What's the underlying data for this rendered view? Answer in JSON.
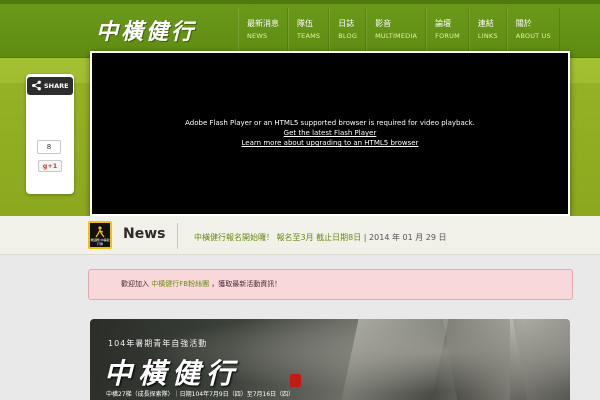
{
  "header": {
    "logo_text": "中橫健行",
    "nav": [
      {
        "zh": "最新消息",
        "en": "NEWS"
      },
      {
        "zh": "隊伍",
        "en": "TEAMS"
      },
      {
        "zh": "日誌",
        "en": "BLOG"
      },
      {
        "zh": "影音",
        "en": "MULTIMEDIA"
      },
      {
        "zh": "論壇",
        "en": "FORUM"
      },
      {
        "zh": "連結",
        "en": "LINKS"
      },
      {
        "zh": "關於",
        "en": "ABOUT US"
      }
    ]
  },
  "share": {
    "label": "SHARE",
    "count": "8",
    "gplus_label": "g+1",
    "icon": "share-icon"
  },
  "player": {
    "message": "Adobe Flash Player or an HTML5 supported browser is required for video playback.",
    "link1": "Get the latest Flash Player",
    "link2": "Learn more about upgrading to an HTML5 browser"
  },
  "news": {
    "logo_caption": "救國團 中橫健行隊",
    "title": "News",
    "headline": "中橫健行報名開始囉！ 報名至3月 截止日期8日",
    "separator": " | ",
    "date": "2014 年 01 月 29 日"
  },
  "notice": {
    "prefix": "歡迎加入",
    "link": "中橫健行FB粉絲團",
    "suffix": "，獲取最新活動資訊！"
  },
  "banner": {
    "subtitle": "104年暑期青年自強活動",
    "title": "中橫健行",
    "info": "中橫27梯（成長探索隊）｜日期104年7月9日（四）至7月16日（四）"
  },
  "colors": {
    "header_green": "#5e8c12",
    "hero_green": "#9dba2c",
    "link_green": "#6a8d10",
    "notice_pink": "#f9d8db"
  }
}
